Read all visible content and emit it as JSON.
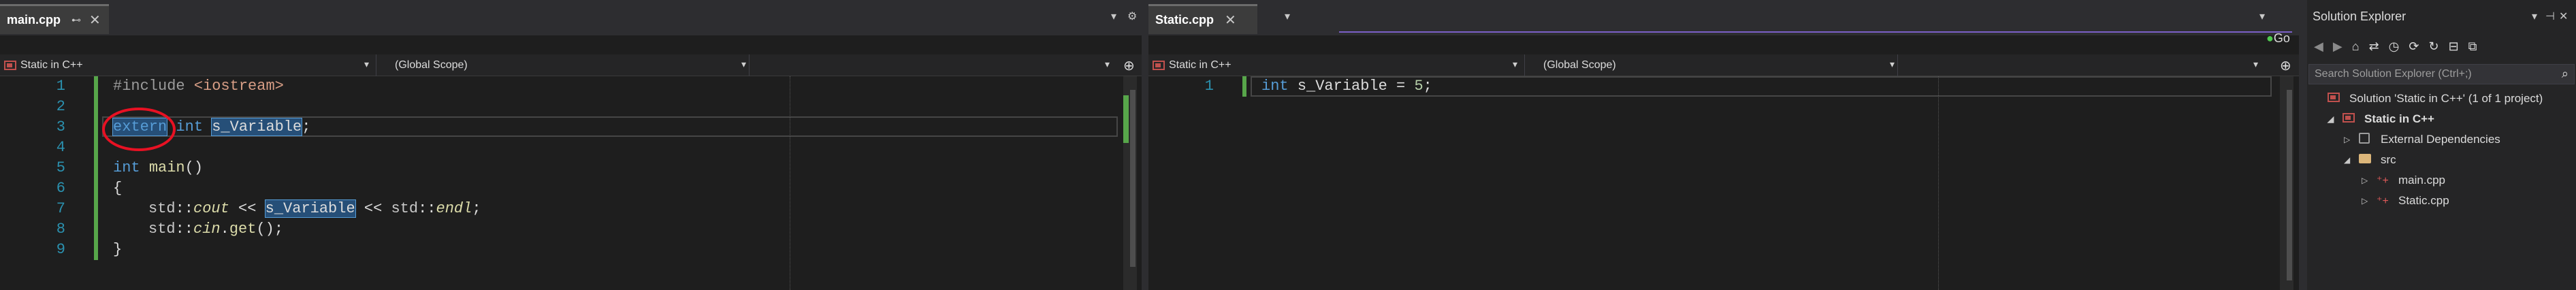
{
  "left_pane": {
    "tab": {
      "name": "main.cpp",
      "pin": "⊷",
      "close": "✕"
    },
    "strip_controls": [
      "▾",
      "⚙"
    ],
    "nav": {
      "project": "Static in C++",
      "scope": "(Global Scope)",
      "member": ""
    },
    "lines": [
      {
        "num": "1"
      },
      {
        "num": "2"
      },
      {
        "num": "3"
      },
      {
        "num": "4"
      },
      {
        "num": "5"
      },
      {
        "num": "6"
      },
      {
        "num": "7"
      },
      {
        "num": "8"
      },
      {
        "num": "9"
      }
    ],
    "code": {
      "l1_directive": "#include",
      "l1_header": "<iostream>",
      "l3_extern": "extern",
      "l3_int": "int",
      "l3_var": "s_Variable",
      "l3_semi": ";",
      "l5_int": "int",
      "l5_main": "main",
      "l5_parens": "()",
      "l6_brace": "{",
      "l7_std": "std",
      "l7_sep1": "::",
      "l7_cout": "cout",
      "l7_op1": " << ",
      "l7_var": "s_Variable",
      "l7_op2": " << ",
      "l7_std2": "std",
      "l7_sep2": "::",
      "l7_endl": "endl",
      "l7_semi": ";",
      "l8_std": "std",
      "l8_sep": "::",
      "l8_cin": "cin",
      "l8_dot": ".",
      "l8_get": "get",
      "l8_tail": "();",
      "l9_brace": "}"
    }
  },
  "right_pane": {
    "tab": {
      "name": "Static.cpp",
      "close": "✕"
    },
    "nav": {
      "project": "Static in C++",
      "scope": "(Global Scope)",
      "member": ""
    },
    "lines": [
      {
        "num": "1"
      }
    ],
    "code": {
      "int": "int",
      "var": "s_Variable",
      "op": " = ",
      "num": "5",
      "semi": ";"
    }
  },
  "toolbar_extra": {
    "go_label": "Go"
  },
  "solution_explorer": {
    "title": "Solution Explorer",
    "controls": [
      "▾",
      "⊣",
      "✕"
    ],
    "search_placeholder": "Search Solution Explorer (Ctrl+;)",
    "tree": [
      {
        "label": "Solution 'Static in C++' (1 of 1 project)",
        "expander": "",
        "icon": "solution-icon",
        "bold": false
      },
      {
        "label": "Static in C++",
        "expander": "◢",
        "icon": "project-icon",
        "bold": true
      },
      {
        "label": "External Dependencies",
        "expander": "▷",
        "icon": "external-deps-icon",
        "bold": false
      },
      {
        "label": "src",
        "expander": "◢",
        "icon": "folder-icon",
        "bold": false
      },
      {
        "label": "main.cpp",
        "expander": "▷",
        "icon": "cpp-file-icon",
        "bold": false
      },
      {
        "label": "Static.cpp",
        "expander": "▷",
        "icon": "cpp-file-icon",
        "bold": false
      }
    ]
  },
  "colors": {
    "keyword": "#569cd6",
    "function": "#dcdcaa",
    "line_number": "#2b91af",
    "change_bar": "#57a64a",
    "annotation": "#e81123"
  }
}
